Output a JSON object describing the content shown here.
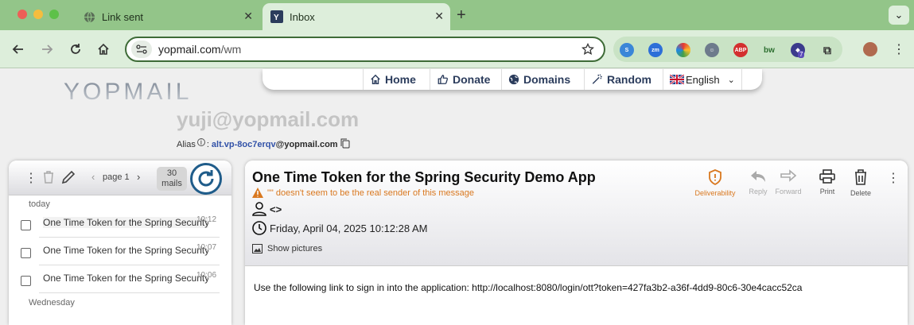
{
  "browser": {
    "tabs": [
      {
        "title": "Link sent",
        "active": false
      },
      {
        "title": "Inbox",
        "active": true
      }
    ],
    "address": {
      "host": "yopmail.com",
      "path": "/wm"
    },
    "extension_badge": "7"
  },
  "site": {
    "logo_text": "YOPMAIL",
    "nav": [
      {
        "label": "Home",
        "icon": "home-icon"
      },
      {
        "label": "Donate",
        "icon": "thumbs-up-icon"
      },
      {
        "label": "Domains",
        "icon": "globe-icon"
      },
      {
        "label": "Random",
        "icon": "magic-wand-icon"
      }
    ],
    "language": "English",
    "email": "yuji@yopmail.com",
    "alias_label": "Alias",
    "alias_local": "alt.vp-8oc7erqv",
    "alias_domain": "@yopmail.com"
  },
  "inbox": {
    "page_label": "page 1",
    "count_num": "30",
    "count_unit": "mails",
    "groups": [
      {
        "label": "today",
        "mails": [
          {
            "subject": "One Time Token for the Spring Security Demo App",
            "time": "10:12"
          },
          {
            "subject": "One Time Token for the Spring Security Demo App",
            "time": "10:07"
          },
          {
            "subject": "One Time Token for the Spring Security Demo App",
            "time": "10:06"
          }
        ]
      },
      {
        "label": "Wednesday",
        "mails": []
      }
    ]
  },
  "message": {
    "subject": "One Time Token for the Spring Security Demo App",
    "warning": "\"\" doesn't seem to be the real sender of this message",
    "from": "<>",
    "date": "Friday, April 04, 2025 10:12:28 AM",
    "show_pictures": "Show pictures",
    "actions": {
      "deliverability": "Deliverability",
      "reply": "Reply",
      "forward": "Forward",
      "print": "Print",
      "delete": "Delete"
    },
    "body": "Use the following link to sign in into the application: http://localhost:8080/login/ott?token=427fa3b2-a36f-4dd9-80c6-30e4cacc52ca"
  },
  "colors": {
    "tabbar": "#93c589",
    "toolbar": "#ddeedb",
    "warning": "#d9781f",
    "link": "#3252a8"
  }
}
